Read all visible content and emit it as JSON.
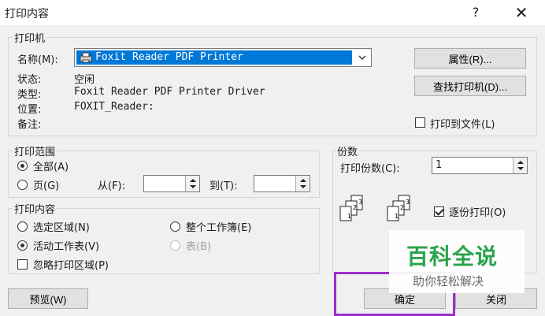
{
  "window": {
    "title": "打印内容",
    "help": "?",
    "close": "✕"
  },
  "printer_group": {
    "legend": "打印机",
    "name_label": "名称(M):",
    "selected_printer": "Foxit Reader PDF Printer",
    "status_label": "状态:",
    "status_value": "空闲",
    "type_label": "类型:",
    "type_value": "Foxit Reader PDF Printer Driver",
    "location_label": "位置:",
    "location_value": "FOXIT_Reader:",
    "comment_label": "备注:",
    "properties_button": "属性(R)...",
    "find_button": "查找打印机(D)...",
    "print_to_file": {
      "label": "打印到文件(L)",
      "checked": false
    }
  },
  "range_group": {
    "legend": "打印范围",
    "all": "全部(A)",
    "pages": "页(G)",
    "from_label": "从(F):",
    "to_label": "到(T):",
    "selected": "all"
  },
  "content_group": {
    "legend": "打印内容",
    "selection": "选定区域(N)",
    "active_sheet": "活动工作表(V)",
    "whole_workbook": "整个工作簿(E)",
    "table": "表(B)",
    "ignore_print_area": "忽略打印区域(P)",
    "selected": "active_sheet"
  },
  "copies_group": {
    "legend": "份数",
    "count_label": "打印份数(C):",
    "count_value": "1",
    "collate_label": "逐份打印(O)",
    "collate_checked": true,
    "icon_pages": [
      "1",
      "2",
      "3"
    ]
  },
  "buttons": {
    "preview": "预览(W)",
    "ok": "确定",
    "close": "关闭"
  },
  "watermark": {
    "brand": "百科全说",
    "slogan": "助你轻松解决"
  },
  "colors": {
    "selection": "#0078d7",
    "highlight_box": "#9b30c8",
    "brand_green": "#2aa34a"
  }
}
